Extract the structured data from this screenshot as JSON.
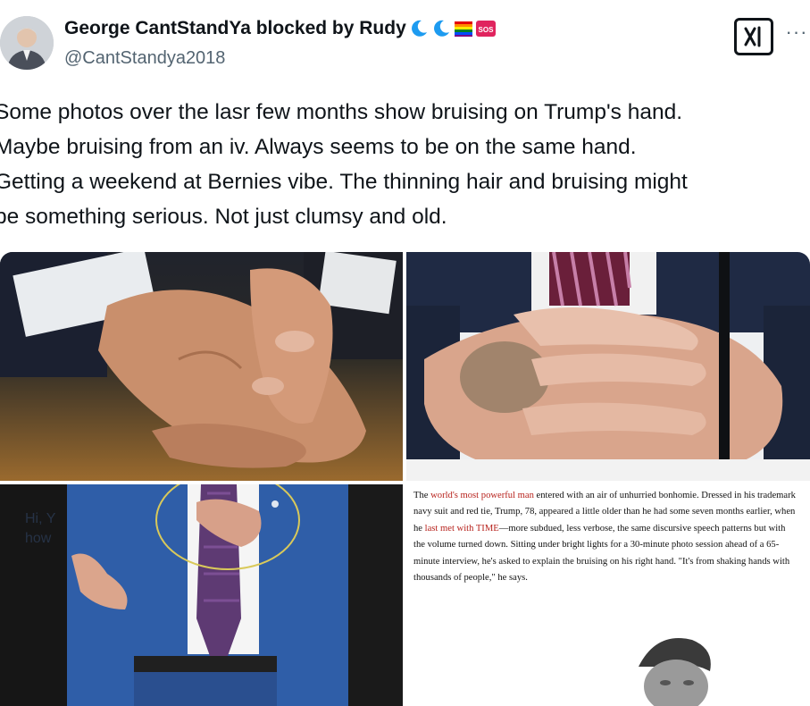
{
  "author": {
    "display_name": "George CantStandYa blocked by Rudy",
    "handle": "@CantStandya2018",
    "badges": [
      "moon-icon",
      "moon-icon",
      "rainbow-flag-icon",
      "sos-icon"
    ],
    "sos_label": "SOS"
  },
  "actions": {
    "more_label": "···"
  },
  "tweet": {
    "lines": [
      "Some photos over the lasr few months show bruising on Trump's hand.",
      "Maybe bruising from an iv. Always seems to be on the same hand.",
      "Getting a weekend at Bernies vibe. The thinning hair and bruising might",
      "be something serious. Not just clumsy and old."
    ]
  },
  "media": {
    "overlay_text": [
      "Hi, Y",
      "how"
    ],
    "article": {
      "p1": "The ",
      "p1_red": "world's most powerful man",
      "p2": " entered with an air of unhurried bonhomie. Dressed in his trademark navy suit and red tie, Trump, 78, appeared a little older than he had some seven months earlier, when he ",
      "p2_red": "last met with TIME",
      "p3": "—more subdued, less verbose, the same discursive speech patterns but with the volume turned down. Sitting under bright lights for a 30-minute photo session ahead of a 65-minute interview, he's asked to explain the bruising on his right hand. \"It's from shaking hands with thousands of people,\" he says."
    }
  },
  "colors": {
    "text": "#0f1419",
    "secondary": "#536471",
    "moon": "#1d9bf0",
    "sos": "#e0245e",
    "article_red": "#b7221c"
  }
}
